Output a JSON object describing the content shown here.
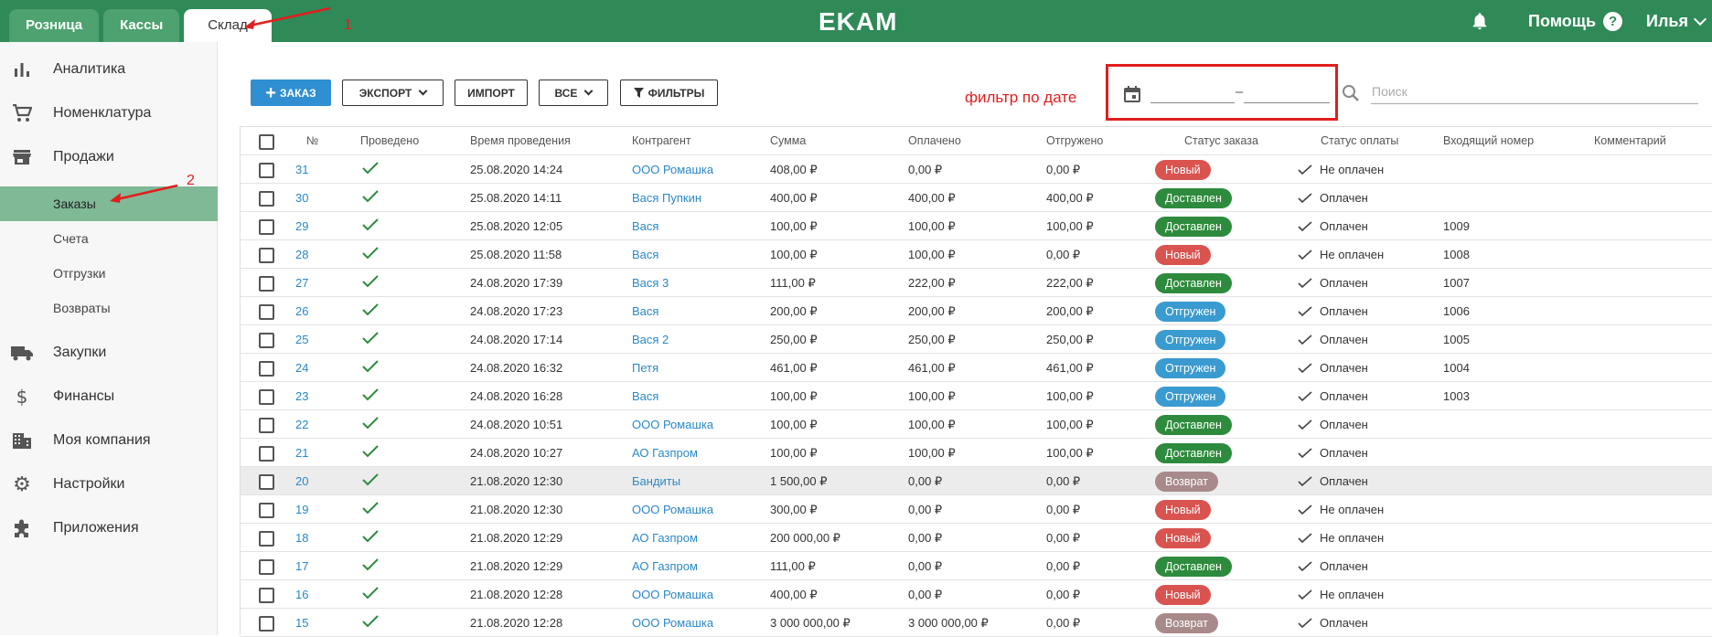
{
  "topbar": {
    "tabs": [
      "Розница",
      "Кассы",
      "Склад"
    ],
    "logo": "EKAM",
    "help_label": "Помощь",
    "help_glyph": "?",
    "user_name": "Илья",
    "brand_color": "#2f8a58"
  },
  "sidebar": {
    "items": [
      {
        "label": "Аналитика",
        "icon": "bar-chart-icon"
      },
      {
        "label": "Номенклатура",
        "icon": "cart-icon"
      },
      {
        "label": "Продажи",
        "icon": "store-icon"
      },
      {
        "label": "Закупки",
        "icon": "truck-icon"
      },
      {
        "label": "Финансы",
        "icon": "dollar-icon"
      },
      {
        "label": "Моя компания",
        "icon": "building-icon"
      },
      {
        "label": "Настройки",
        "icon": "gear-icon"
      },
      {
        "label": "Приложения",
        "icon": "puzzle-icon"
      }
    ],
    "sub_items": [
      "Заказы",
      "Счета",
      "Отгрузки",
      "Возвраты"
    ],
    "active_sub": "Заказы"
  },
  "toolbar": {
    "add_order": "ЗАКАЗ",
    "export": "ЭКСПОРТ",
    "import": "ИМПОРТ",
    "all": "ВСЕ",
    "filters": "ФИЛЬТРЫ",
    "date_separator": "–",
    "search_placeholder": "Поиск"
  },
  "annotations": {
    "date_filter_label": "фильтр по дате",
    "marker_1": "1",
    "marker_2": "2"
  },
  "table": {
    "headers": [
      "№",
      "Проведено",
      "Время проведения",
      "Контрагент",
      "Сумма",
      "Оплачено",
      "Отгружено",
      "Статус заказа",
      "Статус оплаты",
      "Входящий номер",
      "Комментарий"
    ],
    "status_colors": {
      "Новый": "#d9534f",
      "Доставлен": "#2e8b3d",
      "Отгружен": "#3a9bd0",
      "Возврат": "#a88a8a"
    },
    "rows": [
      {
        "num": "31",
        "time": "25.08.2020 14:24",
        "contractor": "ООО Ромашка",
        "sum": "408,00 ₽",
        "paid": "0,00 ₽",
        "shipped": "0,00 ₽",
        "status": "Новый",
        "pay": "Не оплачен",
        "incoming": ""
      },
      {
        "num": "30",
        "time": "25.08.2020 14:11",
        "contractor": "Вася Пупкин",
        "sum": "400,00 ₽",
        "paid": "400,00 ₽",
        "shipped": "400,00 ₽",
        "status": "Доставлен",
        "pay": "Оплачен",
        "incoming": ""
      },
      {
        "num": "29",
        "time": "25.08.2020 12:05",
        "contractor": "Вася",
        "sum": "100,00 ₽",
        "paid": "100,00 ₽",
        "shipped": "100,00 ₽",
        "status": "Доставлен",
        "pay": "Оплачен",
        "incoming": "1009"
      },
      {
        "num": "28",
        "time": "25.08.2020 11:58",
        "contractor": "Вася",
        "sum": "100,00 ₽",
        "paid": "100,00 ₽",
        "shipped": "0,00 ₽",
        "status": "Новый",
        "pay": "Не оплачен",
        "incoming": "1008"
      },
      {
        "num": "27",
        "time": "24.08.2020 17:39",
        "contractor": "Вася 3",
        "sum": "111,00 ₽",
        "paid": "222,00 ₽",
        "shipped": "222,00 ₽",
        "status": "Доставлен",
        "pay": "Оплачен",
        "incoming": "1007"
      },
      {
        "num": "26",
        "time": "24.08.2020 17:23",
        "contractor": "Вася",
        "sum": "200,00 ₽",
        "paid": "200,00 ₽",
        "shipped": "200,00 ₽",
        "status": "Отгружен",
        "pay": "Оплачен",
        "incoming": "1006"
      },
      {
        "num": "25",
        "time": "24.08.2020 17:14",
        "contractor": "Вася 2",
        "sum": "250,00 ₽",
        "paid": "250,00 ₽",
        "shipped": "250,00 ₽",
        "status": "Отгружен",
        "pay": "Оплачен",
        "incoming": "1005"
      },
      {
        "num": "24",
        "time": "24.08.2020 16:32",
        "contractor": "Петя",
        "sum": "461,00 ₽",
        "paid": "461,00 ₽",
        "shipped": "461,00 ₽",
        "status": "Отгружен",
        "pay": "Оплачен",
        "incoming": "1004"
      },
      {
        "num": "23",
        "time": "24.08.2020 16:28",
        "contractor": "Вася",
        "sum": "100,00 ₽",
        "paid": "100,00 ₽",
        "shipped": "100,00 ₽",
        "status": "Отгружен",
        "pay": "Оплачен",
        "incoming": "1003"
      },
      {
        "num": "22",
        "time": "24.08.2020 10:51",
        "contractor": "ООО Ромашка",
        "sum": "100,00 ₽",
        "paid": "100,00 ₽",
        "shipped": "100,00 ₽",
        "status": "Доставлен",
        "pay": "Оплачен",
        "incoming": ""
      },
      {
        "num": "21",
        "time": "24.08.2020 10:27",
        "contractor": "АО Газпром",
        "sum": "100,00 ₽",
        "paid": "100,00 ₽",
        "shipped": "100,00 ₽",
        "status": "Доставлен",
        "pay": "Оплачен",
        "incoming": ""
      },
      {
        "num": "20",
        "time": "21.08.2020 12:30",
        "contractor": "Бандиты",
        "sum": "1 500,00 ₽",
        "paid": "0,00 ₽",
        "shipped": "0,00 ₽",
        "status": "Возврат",
        "pay": "Оплачен",
        "incoming": ""
      },
      {
        "num": "19",
        "time": "21.08.2020 12:30",
        "contractor": "ООО Ромашка",
        "sum": "300,00 ₽",
        "paid": "0,00 ₽",
        "shipped": "0,00 ₽",
        "status": "Новый",
        "pay": "Не оплачен",
        "incoming": ""
      },
      {
        "num": "18",
        "time": "21.08.2020 12:29",
        "contractor": "АО Газпром",
        "sum": "200 000,00 ₽",
        "paid": "0,00 ₽",
        "shipped": "0,00 ₽",
        "status": "Новый",
        "pay": "Не оплачен",
        "incoming": ""
      },
      {
        "num": "17",
        "time": "21.08.2020 12:29",
        "contractor": "АО Газпром",
        "sum": "111,00 ₽",
        "paid": "0,00 ₽",
        "shipped": "0,00 ₽",
        "status": "Доставлен",
        "pay": "Оплачен",
        "incoming": ""
      },
      {
        "num": "16",
        "time": "21.08.2020 12:28",
        "contractor": "ООО Ромашка",
        "sum": "400,00 ₽",
        "paid": "0,00 ₽",
        "shipped": "0,00 ₽",
        "status": "Новый",
        "pay": "Не оплачен",
        "incoming": ""
      },
      {
        "num": "15",
        "time": "21.08.2020 12:28",
        "contractor": "ООО Ромашка",
        "sum": "3 000 000,00 ₽",
        "paid": "3 000 000,00 ₽",
        "shipped": "0,00 ₽",
        "status": "Возврат",
        "pay": "Оплачен",
        "incoming": ""
      }
    ]
  }
}
